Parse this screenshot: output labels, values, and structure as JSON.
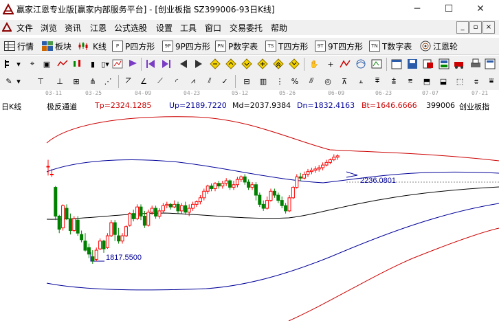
{
  "window": {
    "title": "赢家江恩专业版[赢家内部服务平台] - [创业板指   SZ399006-93日K线]",
    "minimize": "─",
    "maximize": "☐",
    "close": "✕"
  },
  "menu": {
    "items": [
      "文件",
      "浏览",
      "资讯",
      "江恩",
      "公式选股",
      "设置",
      "工具",
      "窗口",
      "交易委托",
      "帮助"
    ],
    "mdi_controls": [
      "_",
      "▫",
      "×"
    ]
  },
  "tabs": [
    {
      "icon": "grid-icon",
      "label": "行情"
    },
    {
      "icon": "block-icon",
      "label": "板块"
    },
    {
      "icon": "kline-icon",
      "label": "K线"
    },
    {
      "icon": "P",
      "label": "P四方形"
    },
    {
      "icon": "9P",
      "label": "9P四方形"
    },
    {
      "icon": "PN",
      "label": "P数字表"
    },
    {
      "icon": "TS",
      "label": "T四方形"
    },
    {
      "icon": "9T",
      "label": "9T四方形"
    },
    {
      "icon": "TN",
      "label": "T数字表"
    },
    {
      "icon": "wheel-icon",
      "label": "江恩轮"
    }
  ],
  "date_axis": [
    "03-11",
    "03-25",
    "04-09",
    "04-23",
    "05-12",
    "05-26",
    "06-09",
    "06-23",
    "07-07",
    "07-21"
  ],
  "info": {
    "chart_label": "日K线",
    "indicator_name": "极反通道",
    "tp": "Tp=2324.1285",
    "up": "Up=2189.7220",
    "md": "Md=2037.9384",
    "dn": "Dn=1832.4163",
    "bt": "Bt=1646.6666",
    "symbol_code": "399006",
    "symbol_name": "创业板指"
  },
  "colors": {
    "up_candle": "#ff0000",
    "down_candle": "#008000",
    "tp_bt_lines": "#cc0000",
    "up_dn_lines": "#000099",
    "md_line": "#000000",
    "annotation": "#000099"
  },
  "chart_data": {
    "type": "candlestick",
    "title": "",
    "annotations": [
      {
        "label": "2236.0801",
        "value": 2236.0801,
        "kind": "high"
      },
      {
        "label": "1817.5500",
        "value": 1817.55,
        "kind": "low"
      }
    ],
    "ylim": [
      1600,
      2400
    ],
    "candles": [
      [
        2190,
        2190,
        2215,
        2155
      ],
      [
        2160,
        2160,
        2180,
        2150
      ],
      [
        2110,
        2000,
        2115,
        1985
      ],
      [
        2000,
        1950,
        2005,
        1935
      ],
      [
        1955,
        2040,
        2045,
        1945
      ],
      [
        2030,
        1990,
        2045,
        1985
      ],
      [
        1990,
        1945,
        2010,
        1930
      ],
      [
        1945,
        1990,
        2000,
        1940
      ],
      [
        1985,
        1935,
        2000,
        1925
      ],
      [
        1930,
        1910,
        1945,
        1900
      ],
      [
        1905,
        1870,
        1935,
        1865
      ],
      [
        1880,
        1855,
        1895,
        1840
      ],
      [
        1845,
        1830,
        1870,
        1818
      ],
      [
        1835,
        1870,
        1880,
        1828
      ],
      [
        1875,
        1905,
        1915,
        1870
      ],
      [
        1905,
        1875,
        1910,
        1860
      ],
      [
        1880,
        1925,
        1935,
        1875
      ],
      [
        1925,
        1975,
        1985,
        1920
      ],
      [
        1975,
        1930,
        1985,
        1905
      ],
      [
        1925,
        1905,
        1955,
        1895
      ],
      [
        1905,
        1925,
        1935,
        1895
      ],
      [
        1925,
        1960,
        1965,
        1920
      ],
      [
        1965,
        2010,
        2015,
        1960
      ],
      [
        2010,
        1990,
        2025,
        1980
      ],
      [
        1990,
        2035,
        2045,
        1985
      ],
      [
        2035,
        2000,
        2045,
        1985
      ],
      [
        2000,
        1965,
        2020,
        1955
      ],
      [
        1965,
        2015,
        2025,
        1960
      ],
      [
        2015,
        2030,
        2040,
        2005
      ],
      [
        2030,
        2000,
        2040,
        1990
      ],
      [
        2000,
        2020,
        2030,
        1990
      ],
      [
        2020,
        2040,
        2050,
        2010
      ],
      [
        2040,
        2045,
        2055,
        2030
      ],
      [
        2045,
        2035,
        2050,
        2025
      ],
      [
        2035,
        2045,
        2060,
        2030
      ],
      [
        2045,
        2020,
        2055,
        2010
      ],
      [
        2020,
        2040,
        2050,
        2010
      ],
      [
        2040,
        2015,
        2055,
        2005
      ],
      [
        2015,
        2030,
        2045,
        2000
      ],
      [
        2030,
        2045,
        2055,
        2020
      ],
      [
        2045,
        2055,
        2060,
        2035
      ],
      [
        2055,
        2070,
        2080,
        2045
      ],
      [
        2070,
        2095,
        2105,
        2060
      ],
      [
        2095,
        2115,
        2120,
        2085
      ],
      [
        2115,
        2105,
        2125,
        2095
      ],
      [
        2105,
        2125,
        2130,
        2095
      ],
      [
        2125,
        2115,
        2135,
        2105
      ],
      [
        2115,
        2125,
        2135,
        2105
      ],
      [
        2125,
        2135,
        2145,
        2115
      ],
      [
        2135,
        2110,
        2140,
        2100
      ],
      [
        2110,
        2120,
        2135,
        2100
      ],
      [
        2120,
        2140,
        2150,
        2110
      ],
      [
        2140,
        2150,
        2155,
        2130
      ],
      [
        2150,
        2130,
        2160,
        2120
      ],
      [
        2130,
        2110,
        2140,
        2100
      ],
      [
        2110,
        2120,
        2130,
        2100
      ],
      [
        2120,
        2080,
        2130,
        2060
      ],
      [
        2080,
        2045,
        2090,
        2035
      ],
      [
        2045,
        2030,
        2060,
        2020
      ],
      [
        2030,
        2060,
        2075,
        2025
      ],
      [
        2060,
        2095,
        2105,
        2055
      ],
      [
        2095,
        2080,
        2105,
        2070
      ],
      [
        2080,
        2060,
        2090,
        2050
      ],
      [
        2060,
        2040,
        2075,
        2030
      ],
      [
        2040,
        2020,
        2050,
        2010
      ],
      [
        2020,
        2070,
        2080,
        2015
      ],
      [
        2070,
        2110,
        2115,
        2065
      ],
      [
        2110,
        2150,
        2160,
        2105
      ],
      [
        2150,
        2145,
        2165,
        2135
      ],
      [
        2145,
        2160,
        2170,
        2140
      ],
      [
        2160,
        2170,
        2180,
        2150
      ],
      [
        2170,
        2175,
        2185,
        2160
      ],
      [
        2175,
        2180,
        2190,
        2165
      ],
      [
        2180,
        2185,
        2195,
        2170
      ],
      [
        2185,
        2195,
        2205,
        2175
      ],
      [
        2195,
        2205,
        2215,
        2190
      ],
      [
        2205,
        2215,
        2220,
        2198
      ],
      [
        2215,
        2225,
        2236,
        2210
      ],
      [
        2225,
        2230,
        2236,
        2215
      ]
    ],
    "bands": [
      {
        "name": "Tp",
        "color": "#cc0000"
      },
      {
        "name": "Up",
        "color": "#000099"
      },
      {
        "name": "Md",
        "color": "#000000"
      },
      {
        "name": "Dn",
        "color": "#000099"
      },
      {
        "name": "Bt",
        "color": "#cc0000"
      }
    ]
  }
}
